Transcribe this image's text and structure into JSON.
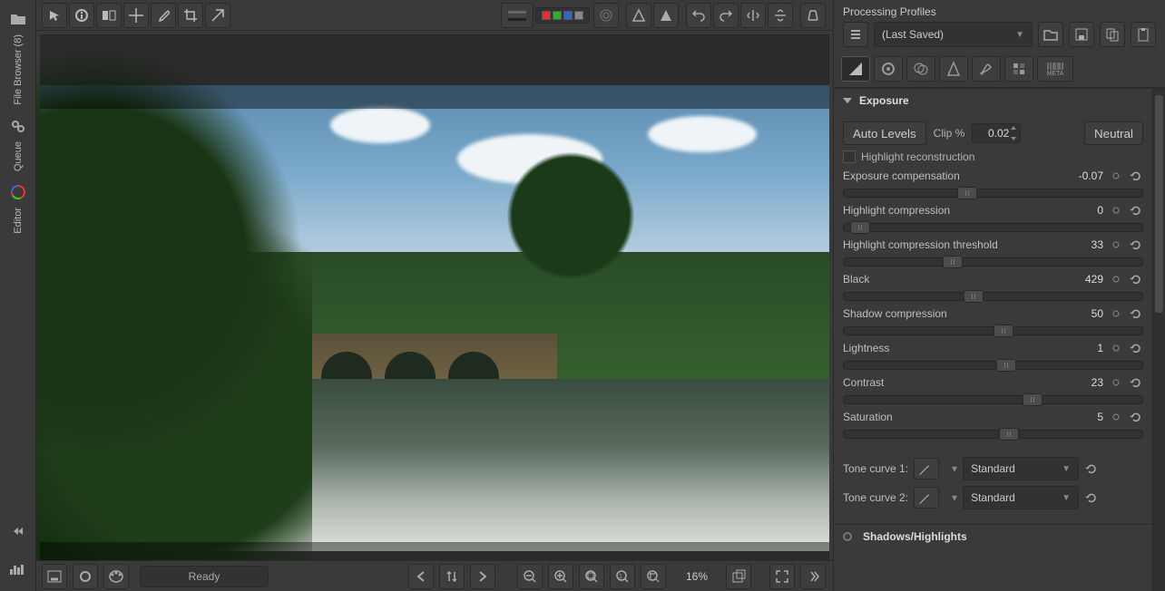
{
  "left_sidebar": {
    "file_browser_label": "File Browser (8)",
    "queue_label": "Queue",
    "editor_label": "Editor"
  },
  "top_toolbar": {
    "color_swatches": [
      "#d33",
      "#3a3",
      "#36c",
      "#888"
    ]
  },
  "bottom_toolbar": {
    "status": "Ready",
    "zoom": "16%"
  },
  "right_panel": {
    "title": "Processing Profiles",
    "profile_value": "(Last Saved)",
    "tool_tabs": [
      "exposure",
      "detail",
      "color",
      "lab",
      "transform",
      "raw",
      "meta"
    ],
    "meta_label": "META",
    "exposure": {
      "title": "Exposure",
      "auto_levels": "Auto Levels",
      "clip_pct_label": "Clip %",
      "clip_pct_value": "0.02",
      "neutral": "Neutral",
      "highlight_recon_label": "Highlight reconstruction",
      "sliders": [
        {
          "label": "Exposure compensation",
          "value": "-0.07",
          "pos": 38
        },
        {
          "label": "Highlight compression",
          "value": "0",
          "pos": 2
        },
        {
          "label": "Highlight compression threshold",
          "value": "33",
          "pos": 33
        },
        {
          "label": "Black",
          "value": "429",
          "pos": 40
        },
        {
          "label": "Shadow compression",
          "value": "50",
          "pos": 50
        },
        {
          "label": "Lightness",
          "value": "1",
          "pos": 51
        },
        {
          "label": "Contrast",
          "value": "23",
          "pos": 60
        },
        {
          "label": "Saturation",
          "value": "5",
          "pos": 52
        }
      ],
      "tone_curve_1_label": "Tone curve 1:",
      "tone_curve_1_value": "Standard",
      "tone_curve_2_label": "Tone curve 2:",
      "tone_curve_2_value": "Standard"
    },
    "shadows_highlights_title": "Shadows/Highlights"
  }
}
